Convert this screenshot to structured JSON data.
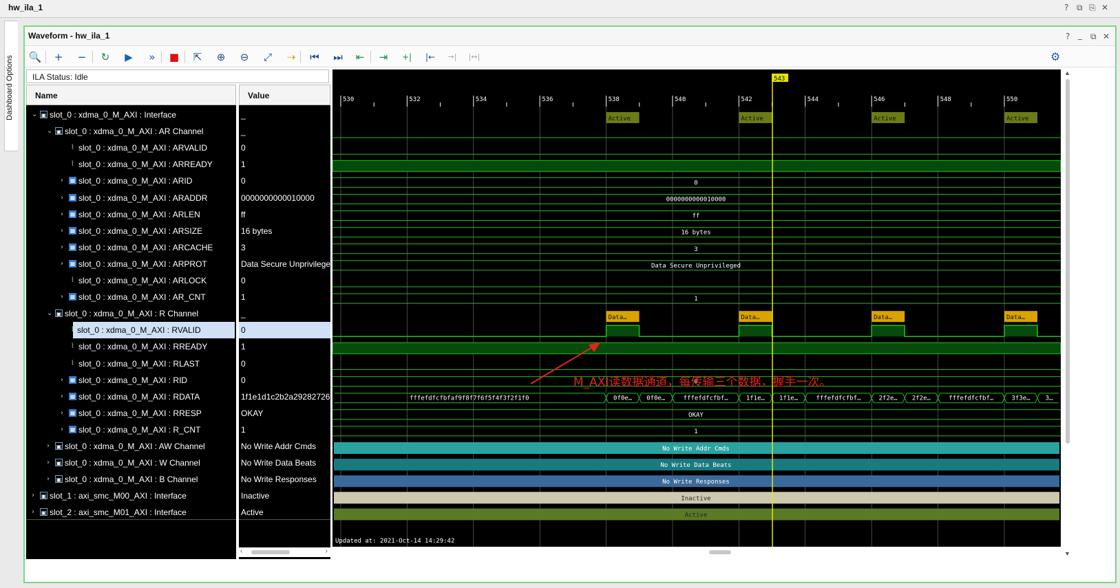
{
  "window": {
    "title": "hw_ila_1",
    "controls": [
      "?",
      "⧉",
      "⎘",
      "✕"
    ]
  },
  "side_tab": {
    "label": "Dashboard Options"
  },
  "waveform": {
    "title": "Waveform - hw_ila_1",
    "controls": [
      "?",
      "_",
      "⧉",
      "✕"
    ]
  },
  "toolbar": {
    "buttons": [
      {
        "name": "search-icon",
        "glyph": "🔍"
      },
      {
        "name": "add-icon",
        "glyph": "+"
      },
      {
        "name": "remove-icon",
        "glyph": "−"
      },
      {
        "name": "auto-rerun-icon",
        "glyph": "↻"
      },
      {
        "name": "run-trigger-icon",
        "glyph": "▶"
      },
      {
        "name": "run-immediate-icon",
        "glyph": "»"
      },
      {
        "name": "stop-icon",
        "glyph": "■"
      },
      {
        "name": "export-icon",
        "glyph": "⇱"
      },
      {
        "name": "zoom-in-icon",
        "glyph": "⊕"
      },
      {
        "name": "zoom-out-icon",
        "glyph": "⊖"
      },
      {
        "name": "zoom-fit-icon",
        "glyph": "⤢"
      },
      {
        "name": "goto-cursor-icon",
        "glyph": "⇢"
      },
      {
        "name": "goto-start-icon",
        "glyph": "⏮"
      },
      {
        "name": "goto-end-icon",
        "glyph": "⏭"
      },
      {
        "name": "prev-transition-icon",
        "glyph": "⇤"
      },
      {
        "name": "next-transition-icon",
        "glyph": "⇥"
      },
      {
        "name": "add-marker-icon",
        "glyph": "+|"
      },
      {
        "name": "prev-marker-icon",
        "glyph": "|←"
      },
      {
        "name": "next-marker-icon",
        "glyph": "→|"
      },
      {
        "name": "swap-cursors-icon",
        "glyph": "|↔|"
      }
    ]
  },
  "status": {
    "text": "ILA Status:  Idle"
  },
  "columns": {
    "name": "Name",
    "value": "Value"
  },
  "rows": [
    {
      "level": 0,
      "expand": "v",
      "icon": "grp",
      "name": "slot_0 : xdma_0_M_AXI : Interface",
      "value": "_"
    },
    {
      "level": 1,
      "expand": "v",
      "icon": "grp",
      "name": "slot_0 : xdma_0_M_AXI : AR Channel",
      "value": "_"
    },
    {
      "level": 2,
      "expand": "",
      "icon": "bit",
      "name": "slot_0 : xdma_0_M_AXI : ARVALID",
      "value": "0"
    },
    {
      "level": 2,
      "expand": "",
      "icon": "bit",
      "name": "slot_0 : xdma_0_M_AXI : ARREADY",
      "value": "1"
    },
    {
      "level": 2,
      "expand": ">",
      "icon": "bus",
      "name": "slot_0 : xdma_0_M_AXI : ARID",
      "value": "0"
    },
    {
      "level": 2,
      "expand": ">",
      "icon": "bus",
      "name": "slot_0 : xdma_0_M_AXI : ARADDR",
      "value": "0000000000010000"
    },
    {
      "level": 2,
      "expand": ">",
      "icon": "bus",
      "name": "slot_0 : xdma_0_M_AXI : ARLEN",
      "value": "ff"
    },
    {
      "level": 2,
      "expand": ">",
      "icon": "bus",
      "name": "slot_0 : xdma_0_M_AXI : ARSIZE",
      "value": "16 bytes"
    },
    {
      "level": 2,
      "expand": ">",
      "icon": "bus",
      "name": "slot_0 : xdma_0_M_AXI : ARCACHE",
      "value": "3"
    },
    {
      "level": 2,
      "expand": ">",
      "icon": "bus",
      "name": "slot_0 : xdma_0_M_AXI : ARPROT",
      "value": "Data Secure Unprivileged"
    },
    {
      "level": 2,
      "expand": "",
      "icon": "bit",
      "name": "slot_0 : xdma_0_M_AXI : ARLOCK",
      "value": "0"
    },
    {
      "level": 2,
      "expand": ">",
      "icon": "bus",
      "name": "slot_0 : xdma_0_M_AXI : AR_CNT",
      "value": "1"
    },
    {
      "level": 1,
      "expand": "v",
      "icon": "grp",
      "name": "slot_0 : xdma_0_M_AXI : R Channel",
      "value": "_"
    },
    {
      "level": 2,
      "expand": "",
      "icon": "bit",
      "name": "slot_0 : xdma_0_M_AXI : RVALID",
      "value": "0",
      "selected": true
    },
    {
      "level": 2,
      "expand": "",
      "icon": "bit",
      "name": "slot_0 : xdma_0_M_AXI : RREADY",
      "value": "1"
    },
    {
      "level": 2,
      "expand": "",
      "icon": "bit",
      "name": "slot_0 : xdma_0_M_AXI : RLAST",
      "value": "0"
    },
    {
      "level": 2,
      "expand": ">",
      "icon": "bus",
      "name": "slot_0 : xdma_0_M_AXI : RID",
      "value": "0"
    },
    {
      "level": 2,
      "expand": ">",
      "icon": "bus",
      "name": "slot_0 : xdma_0_M_AXI : RDATA",
      "value": "1f1e1d1c2b2a29282726"
    },
    {
      "level": 2,
      "expand": ">",
      "icon": "bus",
      "name": "slot_0 : xdma_0_M_AXI : RRESP",
      "value": "OKAY"
    },
    {
      "level": 2,
      "expand": ">",
      "icon": "bus",
      "name": "slot_0 : xdma_0_M_AXI : R_CNT",
      "value": "1"
    },
    {
      "level": 1,
      "expand": ">",
      "icon": "grp",
      "name": "slot_0 : xdma_0_M_AXI : AW Channel",
      "value": "No Write Addr Cmds"
    },
    {
      "level": 1,
      "expand": ">",
      "icon": "grp",
      "name": "slot_0 : xdma_0_M_AXI : W Channel",
      "value": "No Write Data Beats"
    },
    {
      "level": 1,
      "expand": ">",
      "icon": "grp",
      "name": "slot_0 : xdma_0_M_AXI : B Channel",
      "value": "No Write Responses"
    },
    {
      "level": 0,
      "expand": ">",
      "icon": "grp",
      "name": "slot_1 : axi_smc_M00_AXI : Interface",
      "value": "Inactive"
    },
    {
      "level": 0,
      "expand": ">",
      "icon": "grp",
      "name": "slot_2 : axi_smc_M01_AXI : Interface",
      "value": "Active"
    }
  ],
  "timeline": {
    "ticks": [
      "530",
      "532",
      "534",
      "536",
      "538",
      "540",
      "542",
      "544",
      "546",
      "548",
      "550"
    ],
    "cursor": "543",
    "updated": "Updated at:  2021-Oct-14 14:29:42"
  },
  "waves": {
    "active_label": "Active",
    "data_label": "Data…",
    "araddr": "0000000000010000",
    "arid": "0",
    "arlen": "ff",
    "arsize": "16 bytes",
    "arcache": "3",
    "arprot": "Data Secure Unprivileged",
    "ar_cnt": "1",
    "rid": "0",
    "rdata_segments": [
      "fffefdfcfbfaf9f8f7f6f5f4f3f2f1f0",
      "0f0e…",
      "0f0e…",
      "fffefdfcfbf…",
      "1f1e…",
      "1f1e…",
      "fffefdfcfbf…",
      "2f2e…",
      "2f2e…",
      "fffefdfcfbf…",
      "3f3e…",
      "3…"
    ],
    "rresp": "OKAY",
    "r_cnt": "1",
    "aw": "No Write Addr Cmds",
    "w": "No Write Data Beats",
    "b": "No Write Responses",
    "slot1": "Inactive",
    "slot2": "Active"
  },
  "annotation": {
    "text": "M_AXI读数据通道，每传输三个数据，握手一次。"
  },
  "colors": {
    "grid": "#1f8f1f",
    "active_box": "#6b7b17",
    "data_box": "#d9a400",
    "aw": "#2aa2a0",
    "w": "#197a7f",
    "b": "#3a6a9b",
    "inactive": "#cfc8b0",
    "slot2": "#5a7a26",
    "cursor": "#e6e600",
    "annotation": "#e0261a"
  }
}
